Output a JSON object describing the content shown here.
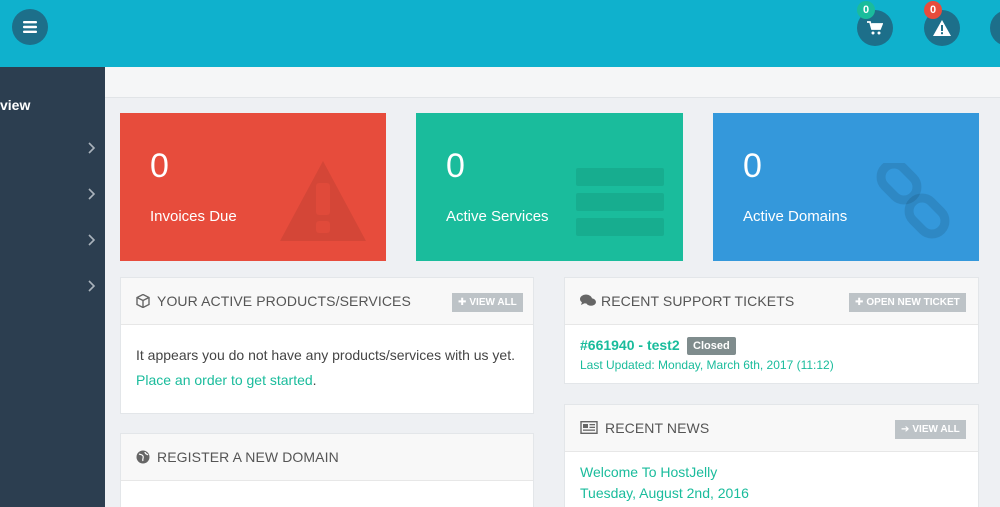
{
  "topbar": {
    "cart_count": "0",
    "alert_count": "0"
  },
  "sidebar": {
    "title": "view",
    "items": 4
  },
  "tiles": [
    {
      "value": "0",
      "label": "Invoices Due",
      "color": "#e74c3c"
    },
    {
      "value": "0",
      "label": "Active Services",
      "color": "#1abc9c"
    },
    {
      "value": "0",
      "label": "Active Domains",
      "color": "#3498db"
    }
  ],
  "products_panel": {
    "title": "YOUR ACTIVE PRODUCTS/SERVICES",
    "button": "VIEW ALL",
    "body_text": "It appears you do not have any products/services with us yet.",
    "link_text": "Place an order to get started",
    "period": "."
  },
  "domain_panel": {
    "title": "REGISTER A NEW DOMAIN"
  },
  "tickets_panel": {
    "title": "RECENT SUPPORT TICKETS",
    "button": "OPEN NEW TICKET",
    "ticket": "#661940 - test2",
    "status": "Closed",
    "updated": "Last Updated: Monday, March 6th, 2017 (11:12)"
  },
  "news_panel": {
    "title": "RECENT NEWS",
    "button": "VIEW ALL",
    "headline": "Welcome To HostJelly",
    "date": "Tuesday, August 2nd, 2016"
  }
}
